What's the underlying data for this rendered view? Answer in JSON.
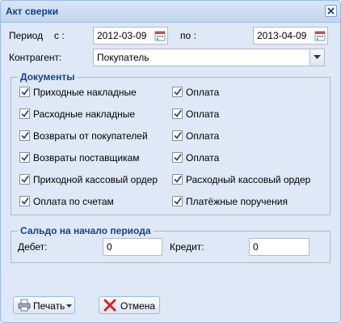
{
  "window": {
    "title": "Акт сверки"
  },
  "period": {
    "label": "Период",
    "from_label": "с :",
    "from_value": "2012-03-09",
    "to_label": "по :",
    "to_value": "2013-04-09"
  },
  "counterparty": {
    "label": "Контрагент:",
    "value": "Покупатель"
  },
  "documents": {
    "legend": "Документы",
    "left": [
      {
        "label": "Приходные накладные",
        "checked": true
      },
      {
        "label": "Расходные накладные",
        "checked": true
      },
      {
        "label": "Возвраты от покупателей",
        "checked": true
      },
      {
        "label": "Возвраты поставщикам",
        "checked": true
      },
      {
        "label": "Приходной кассовый ордер",
        "checked": true
      },
      {
        "label": "Оплата по счетам",
        "checked": true
      }
    ],
    "right": [
      {
        "label": "Оплата",
        "checked": true
      },
      {
        "label": "Оплата",
        "checked": true
      },
      {
        "label": "Оплата",
        "checked": true
      },
      {
        "label": "Оплата",
        "checked": true
      },
      {
        "label": "Расходный кассовый ордер",
        "checked": true
      },
      {
        "label": "Платёжные поручения",
        "checked": true
      }
    ]
  },
  "balance": {
    "legend": "Сальдо на начало периода",
    "debit_label": "Дебет:",
    "debit_value": "0",
    "credit_label": "Кредит:",
    "credit_value": "0"
  },
  "buttons": {
    "print": "Печать",
    "cancel": "Отмена"
  },
  "icons": {
    "close": "close-icon",
    "calendar": "calendar-icon",
    "dropdown": "chevron-down-icon",
    "check": "checkmark-icon",
    "print": "printer-icon",
    "cancel": "cancel-x-icon"
  },
  "colors": {
    "window_bg": "#dfe8f6",
    "title_text": "#15428b",
    "border": "#99bbe8",
    "cancel_icon": "#d9261c"
  }
}
